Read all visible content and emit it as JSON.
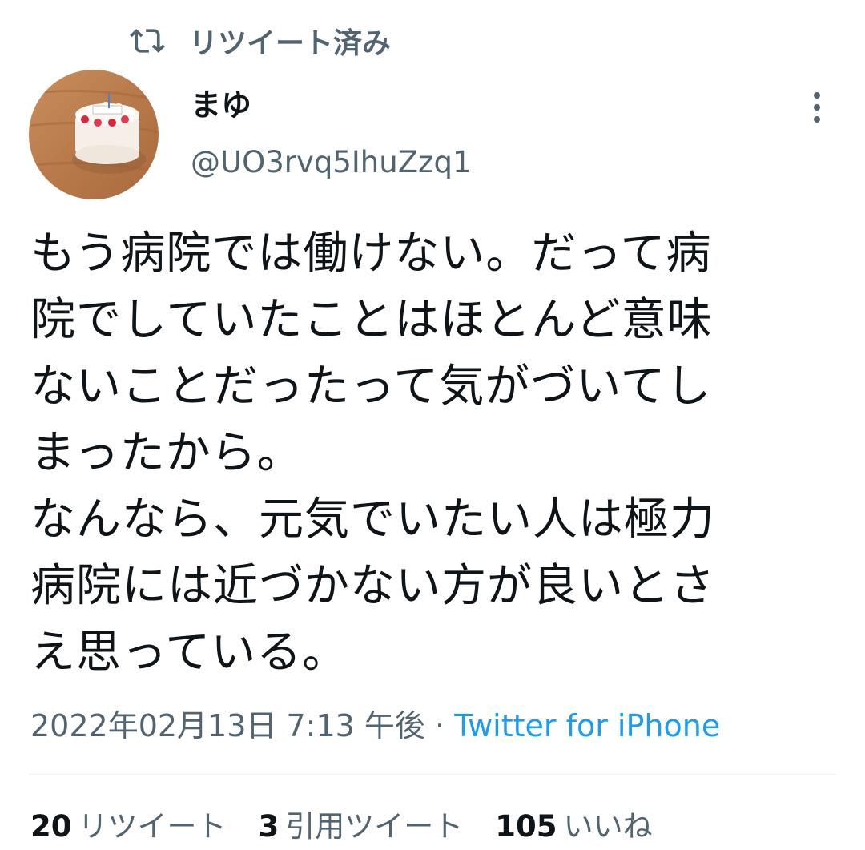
{
  "retweet_banner": {
    "icon": "retweet-icon",
    "label": "リツイート済み"
  },
  "author": {
    "display_name": "まゆ",
    "handle": "@UO3rvq5IhuZzq1",
    "avatar_icon": "birthday-cake-avatar"
  },
  "more_icon": "more-vertical-icon",
  "tweet": {
    "text": "もう病院では働けない。だって病\n院でしていたことはほとんど意味\nないことだったって気がづいてし\nまったから。\nなんなら、元気でいたい人は極力\n病院には近づかない方が良いとさ\nえ思っている。",
    "timestamp": "2022年02月13日 7:13 午後",
    "separator": " · ",
    "source": "Twitter for iPhone"
  },
  "stats": [
    {
      "count": "20",
      "label": "リツイート"
    },
    {
      "count": "3",
      "label": "引用ツイート"
    },
    {
      "count": "105",
      "label": "いいね"
    }
  ],
  "colors": {
    "text_primary": "#0f1419",
    "text_secondary": "#536471",
    "accent": "#1d9bf0",
    "divider": "#eff3f4"
  }
}
